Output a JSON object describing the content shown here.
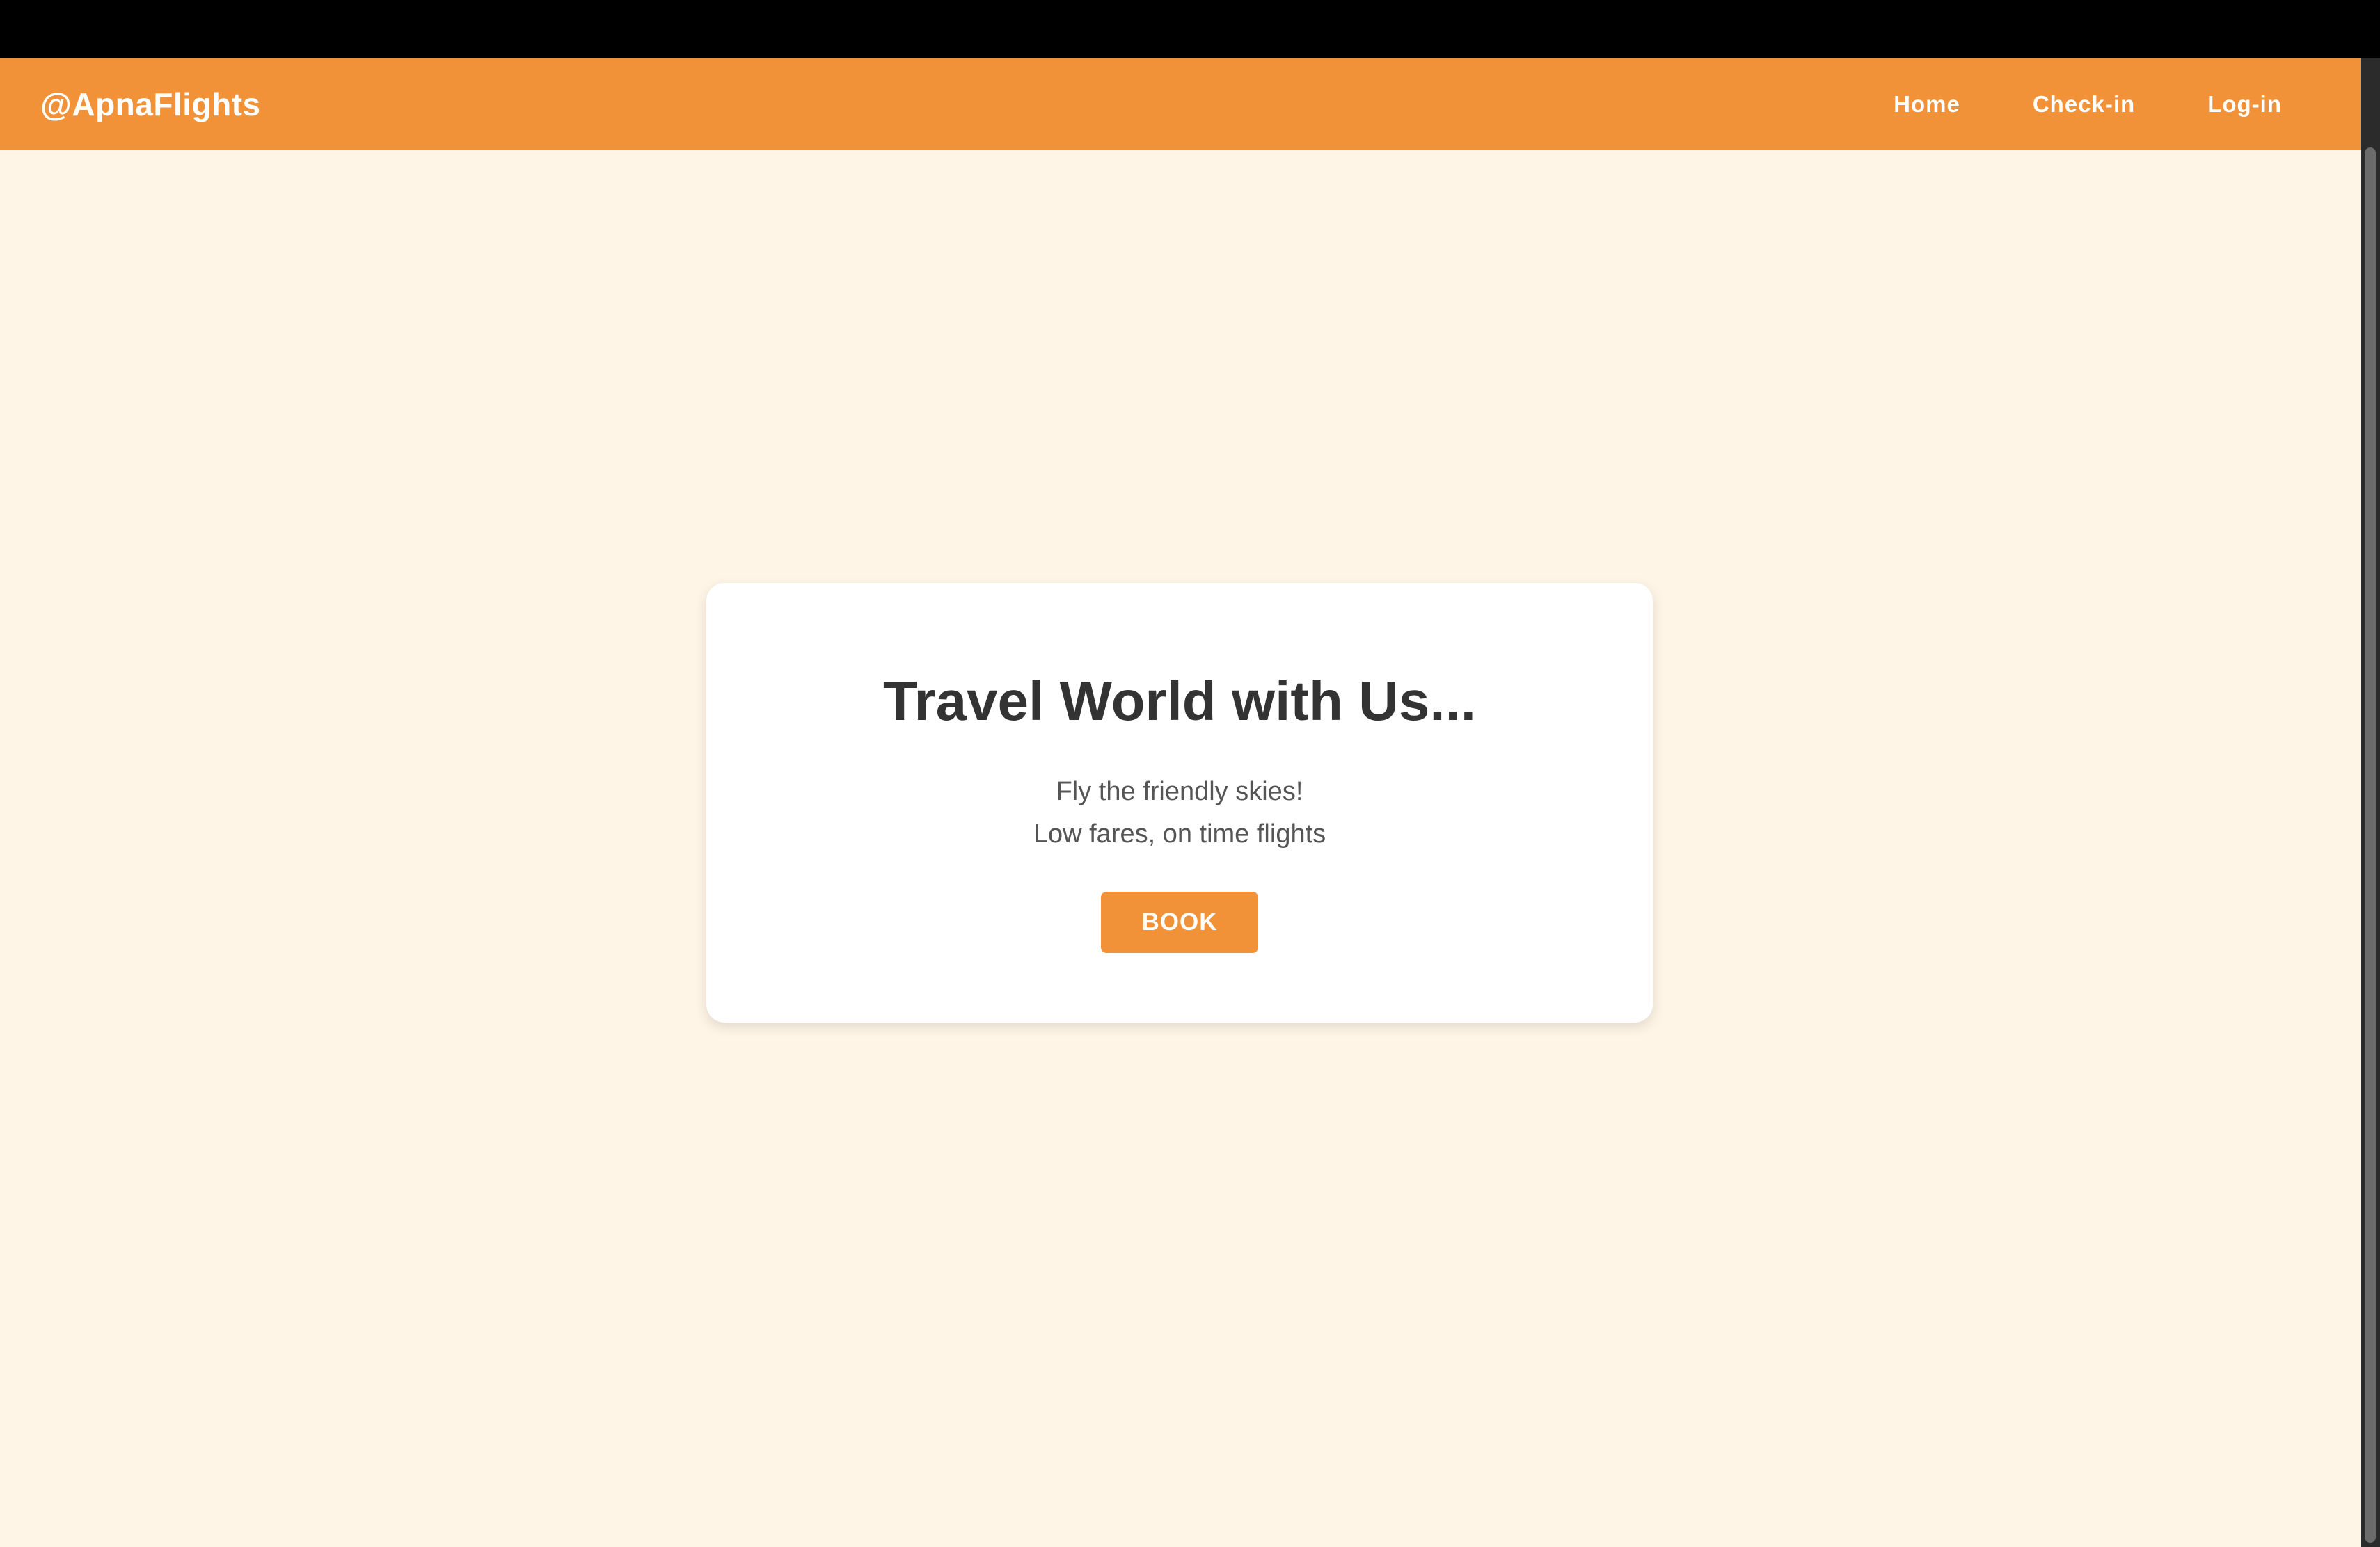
{
  "navbar": {
    "brand": "@ApnaFlights",
    "links": [
      {
        "label": "Home"
      },
      {
        "label": "Check-in"
      },
      {
        "label": "Log-in"
      }
    ]
  },
  "hero": {
    "title": "Travel World with Us...",
    "subtitle_line1": "Fly the friendly skies!",
    "subtitle_line2": "Low fares, on time flights",
    "button_label": "BOOK"
  },
  "colors": {
    "accent": "#F19238",
    "background": "#FEF5E7",
    "card": "#FFFFFF",
    "title_text": "#333333",
    "body_text": "#555555"
  }
}
